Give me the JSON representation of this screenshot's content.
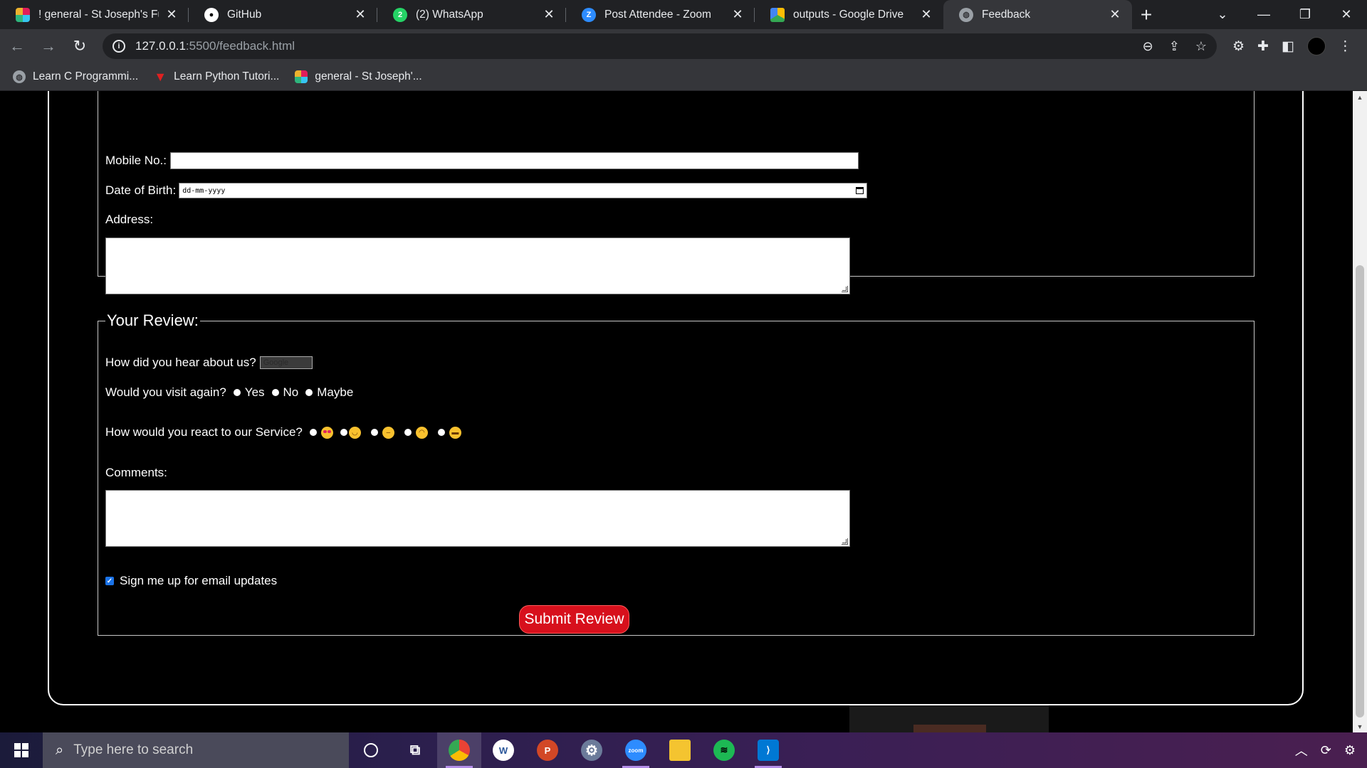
{
  "browser": {
    "tabs": [
      {
        "title": "! general - St Joseph's Full S",
        "icon": "slack-icon",
        "active": false
      },
      {
        "title": "GitHub",
        "icon": "github-icon",
        "active": false
      },
      {
        "title": "(2) WhatsApp",
        "icon": "whatsapp-icon",
        "active": false
      },
      {
        "title": "Post Attendee - Zoom",
        "icon": "zoom-icon",
        "active": false
      },
      {
        "title": "outputs - Google Drive",
        "icon": "google-drive-icon",
        "active": false
      },
      {
        "title": "Feedback",
        "icon": "globe-icon",
        "active": true
      }
    ],
    "url_host": "127.0.0.1",
    "url_path": ":5500/feedback.html",
    "bookmarks": [
      {
        "label": "Learn C Programmi...",
        "icon": "globe-icon"
      },
      {
        "label": "Learn Python Tutori...",
        "icon": "v-logo-icon"
      },
      {
        "label": "general - St Joseph'...",
        "icon": "slack-icon"
      }
    ]
  },
  "form": {
    "mobile_label": "Mobile No.:",
    "dob_label": "Date of Birth:",
    "dob_placeholder": "dd-mm-yyyy",
    "address_label": "Address:",
    "review_legend": "Your Review:",
    "hear_label": "How did you hear about us?",
    "hear_selected": "Google",
    "visit_label": "Would you visit again?",
    "visit_options": [
      "Yes",
      "No",
      "Maybe"
    ],
    "react_label": "How would you react to our Service?",
    "react_options": [
      "heart-eyes-emoji",
      "smiling-emoji",
      "neutral-emoji",
      "frowning-emoji",
      "grimace-emoji"
    ],
    "comments_label": "Comments:",
    "signup_label": "Sign me up for email updates",
    "signup_checked": true,
    "submit_label": "Submit Review"
  },
  "taskbar": {
    "search_placeholder": "Type here to search",
    "apps": [
      "cortana-icon",
      "task-view-icon",
      "chrome-icon",
      "word-icon",
      "powerpoint-icon",
      "settings-icon",
      "zoom-icon",
      "file-explorer-icon",
      "spotify-icon",
      "vscode-icon"
    ]
  },
  "colors": {
    "submit_button": "#d7101c",
    "page_background": "#000000",
    "checkbox_accent": "#1a73e8"
  }
}
